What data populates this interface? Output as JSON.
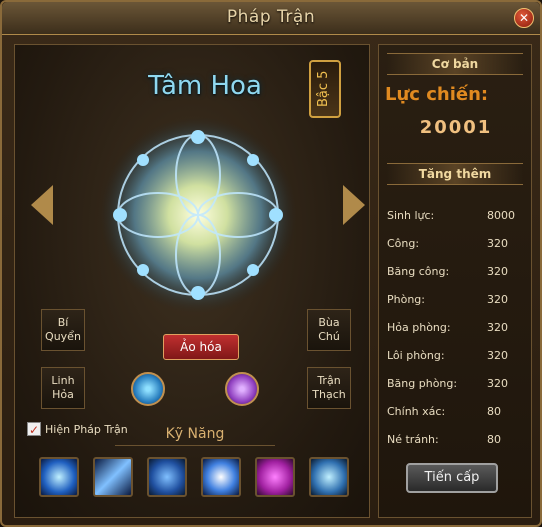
{
  "window": {
    "title": "Pháp Trận",
    "close_icon": "close-icon"
  },
  "formation": {
    "name": "Tâm Hoa",
    "rank": "Bậc 5",
    "transform_label": "Ảo hóa"
  },
  "side_buttons": {
    "bi_quyen": "Bí Quyển",
    "bua_chu": "Bùa Chú",
    "linh_hoa": "Linh Hỏa",
    "tran_thach": "Trận Thạch"
  },
  "show_formation": {
    "label": "Hiện Pháp Trận",
    "checked": true
  },
  "skills": {
    "header": "Kỹ Năng",
    "icons": [
      "spirit-skill-icon",
      "lightning-skill-icon",
      "shield-skill-icon",
      "wing-skill-icon",
      "demon-skill-icon",
      "claw-skill-icon"
    ]
  },
  "stats_panel": {
    "basic_header": "Cơ bản",
    "power_label": "Lực chiến:",
    "power_value": "20001",
    "extra_header": "Tăng thêm",
    "rows": [
      {
        "name": "Sinh lực:",
        "value": "8000"
      },
      {
        "name": "Công:",
        "value": "320"
      },
      {
        "name": "Băng công:",
        "value": "320"
      },
      {
        "name": "Phòng:",
        "value": "320"
      },
      {
        "name": "Hỏa phòng:",
        "value": "320"
      },
      {
        "name": "Lôi phòng:",
        "value": "320"
      },
      {
        "name": "Băng phòng:",
        "value": "320"
      },
      {
        "name": "Chính xác:",
        "value": "80"
      },
      {
        "name": "Né tránh:",
        "value": "80"
      }
    ],
    "advance_label": "Tiến cấp"
  }
}
